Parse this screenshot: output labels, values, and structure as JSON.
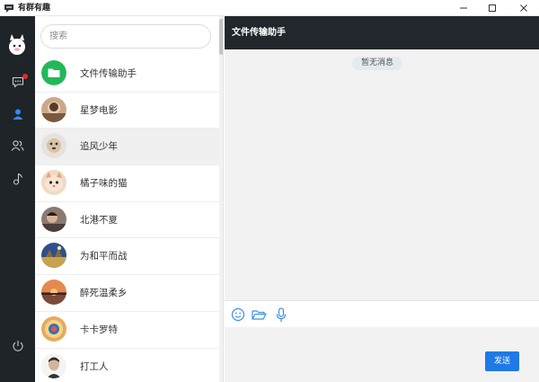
{
  "window": {
    "title": "有群有趣"
  },
  "rail": {
    "items": [
      {
        "icon": "chat-bubble-icon",
        "has_unread": true
      },
      {
        "icon": "contact-person-icon",
        "active": true
      },
      {
        "icon": "group-icon"
      },
      {
        "icon": "music-note-icon"
      }
    ],
    "bottom_icon": "power-icon"
  },
  "search": {
    "placeholder": "搜索"
  },
  "contacts": [
    {
      "name": "文件传输助手",
      "avatar": "folder-avatar"
    },
    {
      "name": "星梦电影",
      "avatar": "photo-avatar"
    },
    {
      "name": "追风少年",
      "avatar": "photo-avatar",
      "selected": true
    },
    {
      "name": "橘子味的猫",
      "avatar": "photo-avatar"
    },
    {
      "name": "北港不夏",
      "avatar": "photo-avatar"
    },
    {
      "name": "为和平而战",
      "avatar": "photo-avatar"
    },
    {
      "name": "醉死温柔乡",
      "avatar": "photo-avatar"
    },
    {
      "name": "卡卡罗特",
      "avatar": "photo-avatar"
    },
    {
      "name": "打工人",
      "avatar": "photo-avatar"
    }
  ],
  "chat": {
    "title": "文件传输助手",
    "empty_text": "暂无消息",
    "toolbar": [
      "emoji-icon",
      "folder-open-icon",
      "microphone-icon"
    ],
    "send_label": "发送"
  },
  "colors": {
    "rail_bg": "#1f2429",
    "header_bg": "#21272c",
    "accent": "#1e7ae6",
    "unread": "#e52a2a",
    "folder_green": "#22b85a"
  }
}
